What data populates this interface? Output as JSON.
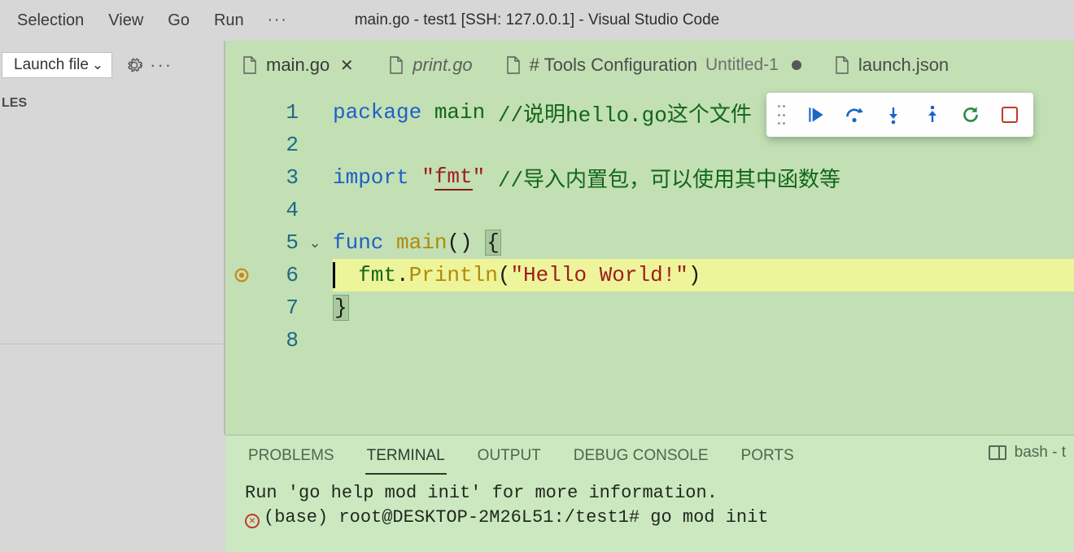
{
  "window": {
    "title": "main.go - test1 [SSH: 127.0.0.1] - Visual Studio Code"
  },
  "menu": {
    "items": [
      "Selection",
      "View",
      "Go",
      "Run"
    ],
    "ellipsis": "···"
  },
  "launch": {
    "label": "Launch file"
  },
  "sidebar": {
    "section_label": "LES"
  },
  "tabs": [
    {
      "name": "main.go",
      "italic": false,
      "has_close": true,
      "dirty": false,
      "secondary": ""
    },
    {
      "name": "print.go",
      "italic": true,
      "has_close": false,
      "dirty": false,
      "secondary": ""
    },
    {
      "name": "# Tools Configuration",
      "italic": false,
      "has_close": false,
      "dirty": true,
      "secondary": "Untitled-1"
    },
    {
      "name": "launch.json",
      "italic": false,
      "has_close": false,
      "dirty": false,
      "secondary": ""
    }
  ],
  "debug_toolbar": {
    "buttons": [
      "continue-icon",
      "step-over-icon",
      "step-into-icon",
      "step-out-icon",
      "restart-icon",
      "stop-icon"
    ]
  },
  "editor": {
    "lines": [
      {
        "n": 1,
        "segments": [
          {
            "t": "package ",
            "c": "tok-kw"
          },
          {
            "t": "main ",
            "c": "tok-ident"
          },
          {
            "t": "//说明hello.go这个文件",
            "c": "tok-comment"
          }
        ]
      },
      {
        "n": 2,
        "segments": []
      },
      {
        "n": 3,
        "segments": [
          {
            "t": "import ",
            "c": "tok-kw"
          },
          {
            "t": "\"",
            "c": "tok-str"
          },
          {
            "t": "fmt",
            "c": "tok-str underline-str"
          },
          {
            "t": "\"",
            "c": "tok-str"
          },
          {
            "t": " //导入内置包，可以使用其中函数等",
            "c": "tok-comment"
          }
        ]
      },
      {
        "n": 4,
        "segments": []
      },
      {
        "n": 5,
        "fold": true,
        "segments": [
          {
            "t": "func ",
            "c": "tok-kw"
          },
          {
            "t": "main",
            "c": "tok-func"
          },
          {
            "t": "() ",
            "c": "tok-black"
          },
          {
            "t": "{",
            "c": "tok-black brace-box"
          }
        ]
      },
      {
        "n": 6,
        "current": true,
        "breakpoint": true,
        "segments": [
          {
            "t": "  fmt",
            "c": "tok-ident"
          },
          {
            "t": ".",
            "c": "tok-black"
          },
          {
            "t": "Println",
            "c": "tok-func"
          },
          {
            "t": "(",
            "c": "tok-black"
          },
          {
            "t": "\"Hello World!\"",
            "c": "tok-str"
          },
          {
            "t": ")",
            "c": "tok-black"
          }
        ]
      },
      {
        "n": 7,
        "segments": [
          {
            "t": "}",
            "c": "tok-black brace-box"
          }
        ]
      },
      {
        "n": 8,
        "segments": []
      }
    ]
  },
  "panel": {
    "tabs": [
      "PROBLEMS",
      "TERMINAL",
      "OUTPUT",
      "DEBUG CONSOLE",
      "PORTS"
    ],
    "active_tab_index": 1,
    "right_label": "bash - t",
    "terminal": {
      "line1": "Run 'go help mod init' for more information.",
      "line2": "(base) root@DESKTOP-2M26L51:/test1# go mod init"
    }
  }
}
